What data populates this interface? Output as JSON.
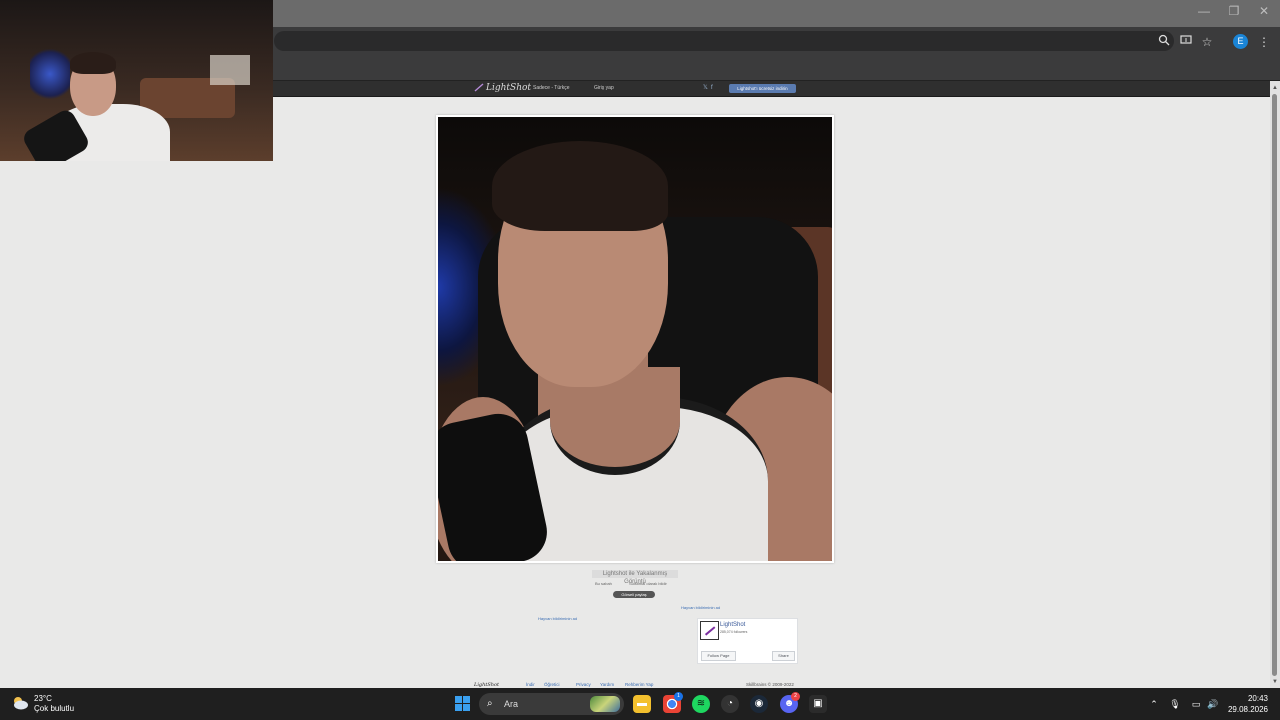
{
  "browser": {
    "profile_initial": "E",
    "window_controls": {
      "minimize": "—",
      "restore": "❐",
      "close": "✕"
    },
    "toolbar_icons": [
      "zoom-icon",
      "install-app-icon",
      "bookmark-star-icon",
      "menu-icon"
    ]
  },
  "lightshot_header": {
    "logo": "LightShot",
    "language": "Sadece - Türkçe",
    "login": "Giriş yap",
    "social": [
      "𝕏",
      "f"
    ],
    "install_button": "Lightshot'ı ücretsiz indirin"
  },
  "screenshot": {
    "caption": "Lightshot ile Yakalanmış Görüntü",
    "meta_date": "Bu sabah",
    "meta_report": "Suistimal olarak bildir",
    "share_button": "Görseli paylaş"
  },
  "ads": {
    "link_right": "Hayvan bildiriminin ad",
    "link_left": "Hayvan bildiriminin ad"
  },
  "facebook_widget": {
    "page_name": "LightShot",
    "followers": "285,074 followers",
    "follow_label": "Follow Page",
    "share_label": "Share"
  },
  "footer": {
    "logo": "LightShot",
    "links": [
      "İndir",
      "Öğretici",
      "Privacy",
      "Yardım",
      "Rehberim Yap"
    ],
    "copyright": "Skillbrains © 2009-2022"
  },
  "taskbar": {
    "weather_temp": "23°C",
    "weather_desc": "Çok bulutlu",
    "search_placeholder": "Ara",
    "apps": [
      "file-explorer-icon",
      "chrome-icon",
      "spotify-icon",
      "media-icon",
      "steam-icon",
      "discord-icon",
      "app-icon"
    ],
    "chrome_badge": "1",
    "discord_badge": "2",
    "time": "20:43",
    "date": "29.08.2026"
  }
}
